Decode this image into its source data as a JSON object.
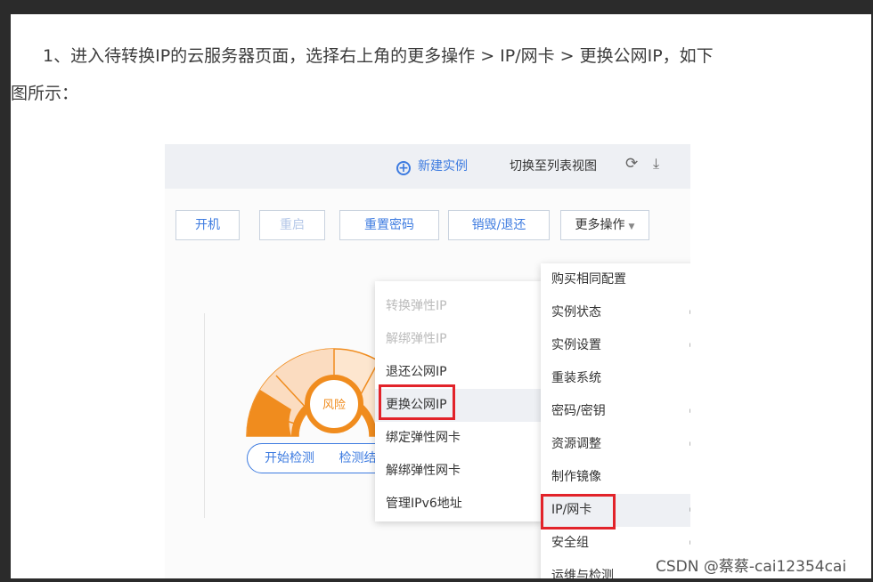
{
  "article": {
    "line1": "1、进入待转换IP的云服务器页面，选择右上角的更多操作 > IP/网卡 > 更换公网IP，如下",
    "line2": "图所示："
  },
  "header": {
    "new_instance": "新建实例",
    "switch_view": "切换至列表视图",
    "refresh_icon": "⟳",
    "download_icon": "⤓"
  },
  "toolbar": {
    "power_on": "开机",
    "restart": "重启",
    "reset_password": "重置密码",
    "destroy": "销毁/退还",
    "more": "更多操作",
    "caret": "▼"
  },
  "submenu": {
    "items": [
      "转换弹性IP",
      "解绑弹性IP",
      "退还公网IP",
      "更换公网IP",
      "绑定弹性网卡",
      "解绑弹性网卡",
      "管理IPv6地址"
    ]
  },
  "main_menu": {
    "items": [
      "购买相同配置",
      "实例状态",
      "实例设置",
      "重装系统",
      "密码/密钥",
      "资源调整",
      "制作镜像",
      "IP/网卡",
      "安全组",
      "运维与检测"
    ],
    "arrow": "▸"
  },
  "gauge": {
    "label": "风险"
  },
  "check": {
    "start": "开始检测",
    "partial": "检测结"
  },
  "watermark": "CSDN @蔡蔡-cai12354cai",
  "colors": {
    "accent": "#3d7be0",
    "gauge": "#f08c1e",
    "highlight": "#e2232a"
  }
}
